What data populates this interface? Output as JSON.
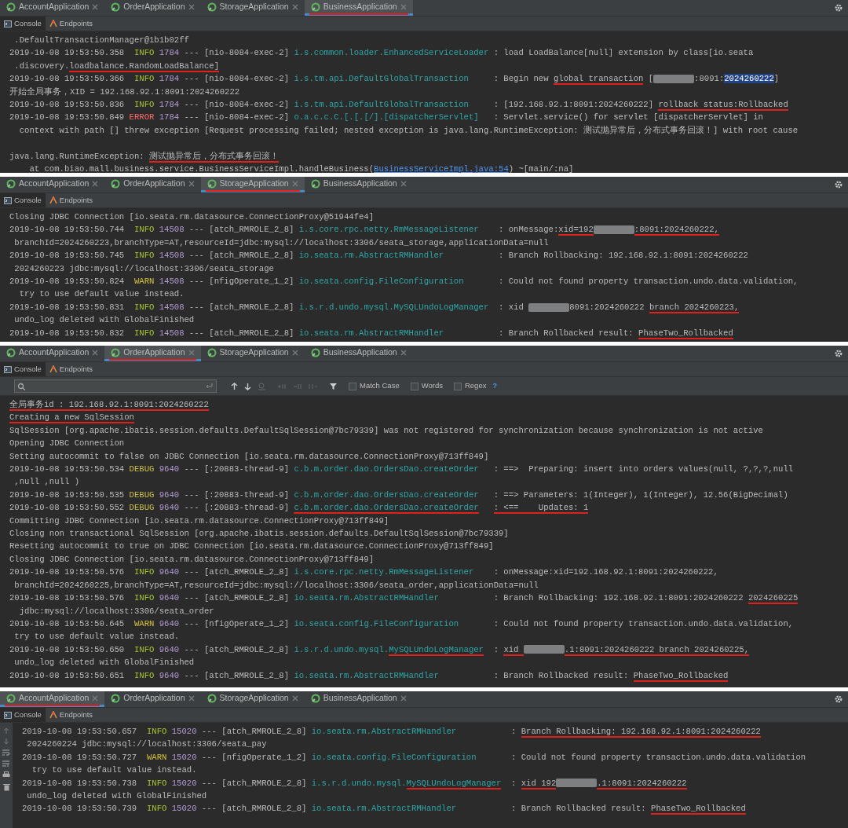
{
  "panels": [
    {
      "tabs": [
        {
          "label": "AccountApplication",
          "selected": false,
          "annotated": false
        },
        {
          "label": "OrderApplication",
          "selected": false,
          "annotated": false
        },
        {
          "label": "StorageApplication",
          "selected": false,
          "annotated": false
        },
        {
          "label": "BusinessApplication",
          "selected": true,
          "annotated": true
        }
      ],
      "tool_tabs": [
        {
          "label": "Console",
          "selected": true
        },
        {
          "label": "Endpoints",
          "selected": false
        }
      ],
      "gutter": false,
      "lines": [
        {
          "kind": "text",
          "segments": [
            {
              "kind": "plain",
              "text": " .DefaultTransactionManager@1b1b02ff"
            }
          ]
        },
        {
          "kind": "log",
          "date": "2019-10-08 19:53:50.358",
          "level": "INFO",
          "pid": "1784",
          "thread": "--- [nio-8084-exec-2]",
          "logger": [
            {
              "kind": "plain",
              "text": "i.s.common.loader.EnhancedServiceLoader"
            }
          ],
          "message": [
            {
              "kind": "plain",
              "text": ": load LoadBalance[null] extension by class[io.seata"
            }
          ]
        },
        {
          "kind": "text",
          "segments": [
            {
              "kind": "plain",
              "text": " .discovery."
            },
            {
              "kind": "marked",
              "text": "loadbalance.RandomLoadBalance]"
            }
          ]
        },
        {
          "kind": "log",
          "date": "2019-10-08 19:53:50.366",
          "level": "INFO",
          "pid": "1784",
          "thread": "--- [nio-8084-exec-2]",
          "logger": [
            {
              "kind": "plain",
              "text": "i.s.tm.api.DefaultGlobalTransaction"
            }
          ],
          "message": [
            {
              "kind": "plain",
              "text": ": Begin new "
            },
            {
              "kind": "marked",
              "text": "global transaction"
            },
            {
              "kind": "plain",
              "text": " ["
            },
            {
              "kind": "redacted"
            },
            {
              "kind": "plain",
              "text": ":8091:"
            },
            {
              "kind": "highlight",
              "text": "2024260222"
            },
            {
              "kind": "plain",
              "text": "]"
            }
          ]
        },
        {
          "kind": "text",
          "segments": [
            {
              "kind": "plain",
              "text": "开始全局事务，XID = 192.168.92.1:8091:2024260222"
            }
          ]
        },
        {
          "kind": "log",
          "date": "2019-10-08 19:53:50.836",
          "level": "INFO",
          "pid": "1784",
          "thread": "--- [nio-8084-exec-2]",
          "logger": [
            {
              "kind": "plain",
              "text": "i.s.tm.api.DefaultGlobalTransaction"
            }
          ],
          "message": [
            {
              "kind": "plain",
              "text": ": [192.168.92.1:8091:2024260222] "
            },
            {
              "kind": "marked",
              "text": "rollback status:Rollbacked"
            }
          ]
        },
        {
          "kind": "log",
          "date": "2019-10-08 19:53:50.849",
          "level": "ERROR",
          "pid": "1784",
          "thread": "--- [nio-8084-exec-2]",
          "logger": [
            {
              "kind": "plain",
              "text": "o.a.c.c.C.[.[.[/].[dispatcherServlet]"
            }
          ],
          "message": [
            {
              "kind": "plain",
              "text": ": Servlet.service() for servlet [dispatcherServlet] in"
            }
          ]
        },
        {
          "kind": "text",
          "segments": [
            {
              "kind": "plain",
              "text": "  context with path [] threw exception [Request processing failed; nested exception is java.lang.RuntimeException: 测试抛异常后，分布式事务回滚！] with root cause"
            }
          ]
        },
        {
          "kind": "blank"
        },
        {
          "kind": "text",
          "segments": [
            {
              "kind": "plain",
              "text": "java.lang.RuntimeException: "
            },
            {
              "kind": "marked",
              "text": "测试抛异常后，分布式事务回滚！"
            }
          ]
        },
        {
          "kind": "text",
          "segments": [
            {
              "kind": "plain",
              "text": "    at com.biao.mall.business.service.BusinessServiceImpl.handleBusiness("
            },
            {
              "kind": "link",
              "text": "BusinessServiceImpl.java:54"
            },
            {
              "kind": "plain",
              "text": ") ~[main/:na]"
            }
          ]
        }
      ]
    },
    {
      "tabs": [
        {
          "label": "AccountApplication",
          "selected": false,
          "annotated": false
        },
        {
          "label": "OrderApplication",
          "selected": false,
          "annotated": false
        },
        {
          "label": "StorageApplication",
          "selected": true,
          "annotated": true
        },
        {
          "label": "BusinessApplication",
          "selected": false,
          "annotated": false
        }
      ],
      "tool_tabs": [
        {
          "label": "Console",
          "selected": true
        },
        {
          "label": "Endpoints",
          "selected": false
        }
      ],
      "gutter": false,
      "lines": [
        {
          "kind": "text",
          "segments": [
            {
              "kind": "plain",
              "text": "Closing JDBC Connection [io.seata.rm.datasource.ConnectionProxy@51944fe4]"
            }
          ]
        },
        {
          "kind": "log",
          "date": "2019-10-08 19:53:50.744",
          "level": "INFO",
          "pid": "14508",
          "thread": "--- [atch_RMROLE_2_8]",
          "logger": [
            {
              "kind": "plain",
              "text": "i.s.core.rpc.netty.RmMessageListener"
            }
          ],
          "message": [
            {
              "kind": "plain",
              "text": ": onMessage:"
            },
            {
              "kind": "marked",
              "text": "xid=192"
            },
            {
              "kind": "redacted"
            },
            {
              "kind": "marked",
              "text": ":8091:2024260222,"
            }
          ]
        },
        {
          "kind": "text",
          "segments": [
            {
              "kind": "plain",
              "text": " branchId=2024260223,branchType=AT,resourceId=jdbc:mysql://localhost:3306/seata_storage,applicationData=null"
            }
          ]
        },
        {
          "kind": "log",
          "date": "2019-10-08 19:53:50.745",
          "level": "INFO",
          "pid": "14508",
          "thread": "--- [atch_RMROLE_2_8]",
          "logger": [
            {
              "kind": "plain",
              "text": "io.seata.rm.AbstractRMHandler"
            }
          ],
          "message": [
            {
              "kind": "plain",
              "text": ": Branch Rollbacking: 192.168.92.1:8091:2024260222"
            }
          ]
        },
        {
          "kind": "text",
          "segments": [
            {
              "kind": "plain",
              "text": " 2024260223 jdbc:mysql://localhost:3306/seata_storage"
            }
          ]
        },
        {
          "kind": "log",
          "date": "2019-10-08 19:53:50.824",
          "level": "WARN",
          "pid": "14508",
          "thread": "--- [nfigOperate_1_2]",
          "logger": [
            {
              "kind": "plain",
              "text": "io.seata.config.FileConfiguration"
            }
          ],
          "message": [
            {
              "kind": "plain",
              "text": ": Could not found property transaction.undo.data.validation,"
            }
          ]
        },
        {
          "kind": "text",
          "segments": [
            {
              "kind": "plain",
              "text": "  try to use default value instead."
            }
          ]
        },
        {
          "kind": "log",
          "date": "2019-10-08 19:53:50.831",
          "level": "INFO",
          "pid": "14508",
          "thread": "--- [atch_RMROLE_2_8]",
          "logger": [
            {
              "kind": "plain",
              "text": "i.s.r.d.undo.mysql.MySQLUndoLogManager"
            }
          ],
          "message": [
            {
              "kind": "plain",
              "text": ": xid "
            },
            {
              "kind": "redacted"
            },
            {
              "kind": "plain",
              "text": "8091:2024260222 "
            },
            {
              "kind": "marked",
              "text": "branch 2024260223,"
            }
          ]
        },
        {
          "kind": "text",
          "segments": [
            {
              "kind": "plain",
              "text": " undo_log deleted with GlobalFinished"
            }
          ]
        },
        {
          "kind": "log",
          "date": "2019-10-08 19:53:50.832",
          "level": "INFO",
          "pid": "14508",
          "thread": "--- [atch_RMROLE_2_8]",
          "logger": [
            {
              "kind": "plain",
              "text": "io.seata.rm.AbstractRMHandler"
            }
          ],
          "message": [
            {
              "kind": "plain",
              "text": ": Branch Rollbacked result: "
            },
            {
              "kind": "marked",
              "text": "PhaseTwo_Rollbacked"
            }
          ]
        }
      ]
    },
    {
      "tabs": [
        {
          "label": "AccountApplication",
          "selected": false,
          "annotated": false
        },
        {
          "label": "OrderApplication",
          "selected": true,
          "annotated": true
        },
        {
          "label": "StorageApplication",
          "selected": false,
          "annotated": false
        },
        {
          "label": "BusinessApplication",
          "selected": false,
          "annotated": false
        }
      ],
      "tool_tabs": [
        {
          "label": "Console",
          "selected": true
        },
        {
          "label": "Endpoints",
          "selected": false
        }
      ],
      "search": {
        "options": [
          {
            "label": "Match Case",
            "checked": false
          },
          {
            "label": "Words",
            "checked": false
          },
          {
            "label": "Regex",
            "checked": false
          }
        ],
        "help": "?"
      },
      "gutter": false,
      "lines": [
        {
          "kind": "text",
          "segments": [
            {
              "kind": "marked",
              "text": "全局事务id : 192.168.92.1:8091:2024260222"
            }
          ]
        },
        {
          "kind": "text",
          "segments": [
            {
              "kind": "marked",
              "text": "Creating a new SqlSession"
            }
          ]
        },
        {
          "kind": "text",
          "segments": [
            {
              "kind": "plain",
              "text": "SqlSession [org.apache.ibatis.session.defaults.DefaultSqlSession@7bc79339] was not registered for synchronization because synchronization is not active"
            }
          ]
        },
        {
          "kind": "text",
          "segments": [
            {
              "kind": "plain",
              "text": "Opening JDBC Connection"
            }
          ]
        },
        {
          "kind": "text",
          "segments": [
            {
              "kind": "plain",
              "text": "Setting autocommit to false on JDBC Connection [io.seata.rm.datasource.ConnectionProxy@713ff849]"
            }
          ]
        },
        {
          "kind": "log",
          "date": "2019-10-08 19:53:50.534",
          "level": "DEBUG",
          "pid": "9640",
          "thread": "--- [:20883-thread-9]",
          "logger": [
            {
              "kind": "plain",
              "text": "c.b.m.order.dao.OrdersDao.createOrder"
            }
          ],
          "message": [
            {
              "kind": "plain",
              "text": ": ==>  Preparing: insert into orders values(null, ?,?,?,null"
            }
          ]
        },
        {
          "kind": "text",
          "segments": [
            {
              "kind": "plain",
              "text": " ,null ,null )"
            }
          ]
        },
        {
          "kind": "log",
          "date": "2019-10-08 19:53:50.535",
          "level": "DEBUG",
          "pid": "9640",
          "thread": "--- [:20883-thread-9]",
          "logger": [
            {
              "kind": "plain",
              "text": "c.b.m.order.dao.OrdersDao.createOrder"
            }
          ],
          "message": [
            {
              "kind": "plain",
              "text": ": ==> Parameters: 1(Integer), 1(Integer), 12.56(BigDecimal)"
            }
          ]
        },
        {
          "kind": "log",
          "date": "2019-10-08 19:53:50.552",
          "level": "DEBUG",
          "pid": "9640",
          "thread": "--- [:20883-thread-9]",
          "logger": [
            {
              "kind": "marked",
              "text": "c.b.m.order.dao.OrdersDao.createOrder"
            }
          ],
          "message": [
            {
              "kind": "marked",
              "text": ": <==    Updates: 1"
            }
          ]
        },
        {
          "kind": "text",
          "segments": [
            {
              "kind": "plain",
              "text": "Committing JDBC Connection [io.seata.rm.datasource.ConnectionProxy@713ff849]"
            }
          ]
        },
        {
          "kind": "text",
          "segments": [
            {
              "kind": "plain",
              "text": "Closing non transactional SqlSession [org.apache.ibatis.session.defaults.DefaultSqlSession@7bc79339]"
            }
          ]
        },
        {
          "kind": "text",
          "segments": [
            {
              "kind": "plain",
              "text": "Resetting autocommit to true on JDBC Connection [io.seata.rm.datasource.ConnectionProxy@713ff849]"
            }
          ]
        },
        {
          "kind": "text",
          "segments": [
            {
              "kind": "plain",
              "text": "Closing JDBC Connection [io.seata.rm.datasource.ConnectionProxy@713ff849]"
            }
          ]
        },
        {
          "kind": "log",
          "date": "2019-10-08 19:53:50.576",
          "level": "INFO",
          "pid": "9640",
          "thread": "--- [atch_RMROLE_2_8]",
          "logger": [
            {
              "kind": "plain",
              "text": "i.s.core.rpc.netty.RmMessageListener"
            }
          ],
          "message": [
            {
              "kind": "plain",
              "text": ": onMessage:xid=192.168.92.1:8091:2024260222,"
            }
          ]
        },
        {
          "kind": "text",
          "segments": [
            {
              "kind": "plain",
              "text": " branchId=2024260225,branchType=AT,resourceId=jdbc:mysql://localhost:3306/seata_order,applicationData=null"
            }
          ]
        },
        {
          "kind": "log",
          "date": "2019-10-08 19:53:50.576",
          "level": "INFO",
          "pid": "9640",
          "thread": "--- [atch_RMROLE_2_8]",
          "logger": [
            {
              "kind": "plain",
              "text": "io.seata.rm.AbstractRMHandler"
            }
          ],
          "message": [
            {
              "kind": "plain",
              "text": ": Branch Rollbacking: 192.168.92.1:8091:2024260222 "
            },
            {
              "kind": "marked",
              "text": "2024260225"
            }
          ]
        },
        {
          "kind": "text",
          "segments": [
            {
              "kind": "plain",
              "text": "  jdbc:mysql://localhost:3306/seata_order"
            }
          ]
        },
        {
          "kind": "log",
          "date": "2019-10-08 19:53:50.645",
          "level": "WARN",
          "pid": "9640",
          "thread": "--- [nfigOperate_1_2]",
          "logger": [
            {
              "kind": "plain",
              "text": "io.seata.config.FileConfiguration"
            }
          ],
          "message": [
            {
              "kind": "plain",
              "text": ": Could not found property transaction.undo.data.validation,"
            }
          ]
        },
        {
          "kind": "text",
          "segments": [
            {
              "kind": "plain",
              "text": " try to use default value instead."
            }
          ]
        },
        {
          "kind": "log",
          "date": "2019-10-08 19:53:50.650",
          "level": "INFO",
          "pid": "9640",
          "thread": "--- [atch_RMROLE_2_8]",
          "logger": [
            {
              "kind": "plain",
              "text": "i.s.r.d.undo.mysql."
            },
            {
              "kind": "marked",
              "text": "MySQLUndoLogManager"
            }
          ],
          "message": [
            {
              "kind": "plain",
              "text": ": "
            },
            {
              "kind": "marked",
              "text": "xid "
            },
            {
              "kind": "redacted"
            },
            {
              "kind": "marked",
              "text": ".1:8091:2024260222 branch 2024260225,"
            }
          ]
        },
        {
          "kind": "text",
          "segments": [
            {
              "kind": "plain",
              "text": " undo_log deleted with GlobalFinished"
            }
          ]
        },
        {
          "kind": "log",
          "date": "2019-10-08 19:53:50.651",
          "level": "INFO",
          "pid": "9640",
          "thread": "--- [atch_RMROLE_2_8]",
          "logger": [
            {
              "kind": "plain",
              "text": "io.seata.rm.AbstractRMHandler"
            }
          ],
          "message": [
            {
              "kind": "plain",
              "text": ": Branch Rollbacked result: "
            },
            {
              "kind": "marked",
              "text": "PhaseTwo_Rollbacked"
            }
          ]
        }
      ]
    },
    {
      "tabs": [
        {
          "label": "AccountApplication",
          "selected": true,
          "annotated": true
        },
        {
          "label": "OrderApplication",
          "selected": false,
          "annotated": false
        },
        {
          "label": "StorageApplication",
          "selected": false,
          "annotated": false
        },
        {
          "label": "BusinessApplication",
          "selected": false,
          "annotated": false
        }
      ],
      "tool_tabs": [
        {
          "label": "Console",
          "selected": true
        },
        {
          "label": "Endpoints",
          "selected": false
        }
      ],
      "gutter": true,
      "lines": [
        {
          "kind": "log",
          "date": "2019-10-08 19:53:50.657",
          "level": "INFO",
          "pid": "15020",
          "thread": "--- [atch_RMROLE_2_8]",
          "logger": [
            {
              "kind": "plain",
              "text": "io.seata.rm.AbstractRMHandler"
            }
          ],
          "message": [
            {
              "kind": "plain",
              "text": ": "
            },
            {
              "kind": "marked",
              "text": "Branch Rollbacking: 192.168.92.1:8091:2024260222"
            }
          ]
        },
        {
          "kind": "text",
          "segments": [
            {
              "kind": "plain",
              "text": " 2024260224 jdbc:mysql://localhost:3306/seata_pay"
            }
          ]
        },
        {
          "kind": "log",
          "date": "2019-10-08 19:53:50.727",
          "level": "WARN",
          "pid": "15020",
          "thread": "--- [nfigOperate_1_2]",
          "logger": [
            {
              "kind": "plain",
              "text": "io.seata.config.FileConfiguration"
            }
          ],
          "message": [
            {
              "kind": "plain",
              "text": ": Could not found property transaction.undo.data.validation"
            }
          ]
        },
        {
          "kind": "text",
          "segments": [
            {
              "kind": "plain",
              "text": "  try to use default value instead."
            }
          ]
        },
        {
          "kind": "log",
          "date": "2019-10-08 19:53:50.738",
          "level": "INFO",
          "pid": "15020",
          "thread": "--- [atch_RMROLE_2_8]",
          "logger": [
            {
              "kind": "plain",
              "text": "i.s.r.d.undo.mysql."
            },
            {
              "kind": "marked",
              "text": "MySQLUndoLogManager"
            }
          ],
          "message": [
            {
              "kind": "plain",
              "text": ": "
            },
            {
              "kind": "marked",
              "text": "xid 192"
            },
            {
              "kind": "redacted"
            },
            {
              "kind": "marked",
              "text": ".1:8091:2024260222"
            }
          ]
        },
        {
          "kind": "text",
          "segments": [
            {
              "kind": "plain",
              "text": " undo_log deleted with GlobalFinished"
            }
          ]
        },
        {
          "kind": "log",
          "date": "2019-10-08 19:53:50.739",
          "level": "INFO",
          "pid": "15020",
          "thread": "--- [atch_RMROLE_2_8]",
          "logger": [
            {
              "kind": "plain",
              "text": "io.seata.rm.AbstractRMHandler"
            }
          ],
          "message": [
            {
              "kind": "plain",
              "text": ": Branch Rollbacked result: "
            },
            {
              "kind": "marked",
              "text": "PhaseTwo_Rollbacked"
            }
          ]
        }
      ]
    }
  ]
}
